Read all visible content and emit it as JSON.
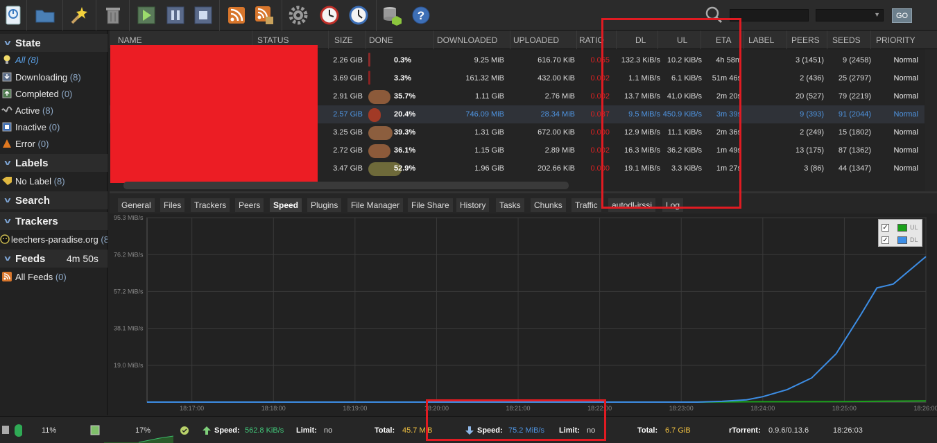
{
  "toolbar": {
    "buttons": [
      "add-torrent",
      "add-url",
      "create-torrent",
      "remove",
      "start",
      "pause",
      "stop",
      "rss",
      "rss-feeds",
      "settings",
      "scheduler",
      "time",
      "plugins",
      "help"
    ],
    "search_placeholder": "",
    "search_engine_selected": "",
    "go_label": "GO"
  },
  "sidebar": {
    "state": {
      "title": "State",
      "items": [
        {
          "label": "All",
          "count": "(8)",
          "icon": "bulb-icon"
        },
        {
          "label": "Downloading",
          "count": "(8)",
          "icon": "download-icon"
        },
        {
          "label": "Completed",
          "count": "(0)",
          "icon": "completed-icon"
        },
        {
          "label": "Active",
          "count": "(8)",
          "icon": "active-icon"
        },
        {
          "label": "Inactive",
          "count": "(0)",
          "icon": "inactive-icon"
        },
        {
          "label": "Error",
          "count": "(0)",
          "icon": "error-icon"
        }
      ]
    },
    "labels": {
      "title": "Labels",
      "items": [
        {
          "label": "No Label",
          "count": "(8)"
        }
      ]
    },
    "search": {
      "title": "Search"
    },
    "trackers": {
      "title": "Trackers",
      "items": [
        {
          "label": "leechers-paradise.org",
          "count": "(8"
        }
      ]
    },
    "feeds": {
      "title": "Feeds",
      "timer": "4m 50s",
      "items": [
        {
          "label": "All Feeds",
          "count": "(0)"
        }
      ]
    }
  },
  "list": {
    "columns": [
      "NAME",
      "STATUS",
      "SIZE",
      "DONE",
      "DOWNLOADED",
      "UPLOADED",
      "RATIO",
      "DL",
      "UL",
      "ETA",
      "LABEL",
      "PEERS",
      "SEEDS",
      "PRIORITY"
    ],
    "rows": [
      {
        "size": "2.26 GiB",
        "done": "0.3%",
        "downloaded": "9.25 MiB",
        "uploaded": "616.70 KiB",
        "ratio": "0.065",
        "dl": "132.3 KiB/s",
        "ul": "10.2 KiB/s",
        "eta": "4h 58m",
        "peers": "3 (1451)",
        "seeds": "9 (2458)",
        "priority": "Normal",
        "progress": 0.003,
        "blob_color": "#8a2a2a"
      },
      {
        "size": "3.69 GiB",
        "done": "3.3%",
        "downloaded": "161.32 MiB",
        "uploaded": "432.00 KiB",
        "ratio": "0.002",
        "dl": "1.1 MiB/s",
        "ul": "6.1 KiB/s",
        "eta": "51m 46s",
        "peers": "2 (436)",
        "seeds": "25 (2797)",
        "priority": "Normal",
        "progress": 0.033,
        "blob_color": "#8a2222"
      },
      {
        "size": "2.91 GiB",
        "done": "35.7%",
        "downloaded": "1.11 GiB",
        "uploaded": "2.76 MiB",
        "ratio": "0.002",
        "dl": "13.7 MiB/s",
        "ul": "41.0 KiB/s",
        "eta": "2m 20s",
        "peers": "20 (527)",
        "seeds": "79 (2219)",
        "priority": "Normal",
        "progress": 0.357,
        "blob_color": "#8c5a3a"
      },
      {
        "size": "2.57 GiB",
        "done": "20.4%",
        "downloaded": "746.09 MiB",
        "uploaded": "28.34 MiB",
        "ratio": "0.037",
        "dl": "9.5 MiB/s",
        "ul": "450.9 KiB/s",
        "eta": "3m 39s",
        "peers": "9 (393)",
        "seeds": "91 (2044)",
        "priority": "Normal",
        "progress": 0.204,
        "blob_color": "#a23a26",
        "selected": true
      },
      {
        "size": "3.25 GiB",
        "done": "39.3%",
        "downloaded": "1.31 GiB",
        "uploaded": "672.00 KiB",
        "ratio": "0.000",
        "dl": "12.9 MiB/s",
        "ul": "11.1 KiB/s",
        "eta": "2m 36s",
        "peers": "2 (249)",
        "seeds": "15 (1802)",
        "priority": "Normal",
        "progress": 0.393,
        "blob_color": "#8c5e3e"
      },
      {
        "size": "2.72 GiB",
        "done": "36.1%",
        "downloaded": "1.15 GiB",
        "uploaded": "2.89 MiB",
        "ratio": "0.002",
        "dl": "16.3 MiB/s",
        "ul": "36.2 KiB/s",
        "eta": "1m 49s",
        "peers": "13 (175)",
        "seeds": "87 (1362)",
        "priority": "Normal",
        "progress": 0.361,
        "blob_color": "#8c5a3a"
      },
      {
        "size": "3.47 GiB",
        "done": "52.9%",
        "downloaded": "1.96 GiB",
        "uploaded": "202.66 KiB",
        "ratio": "0.000",
        "dl": "19.1 MiB/s",
        "ul": "3.3 KiB/s",
        "eta": "1m 27s",
        "peers": "3 (86)",
        "seeds": "44 (1347)",
        "priority": "Normal",
        "progress": 0.529,
        "blob_color": "#6e6a3a"
      }
    ]
  },
  "tabs": [
    "General",
    "Files",
    "Trackers",
    "Peers",
    "Speed",
    "Plugins",
    "File Manager",
    "File Share",
    "History",
    "Tasks",
    "Chunks",
    "Traffic",
    "autodl-irssi",
    "Log"
  ],
  "active_tab": "Speed",
  "chart_data": {
    "type": "line",
    "title": "",
    "xlabel": "",
    "ylabel": "",
    "y_ticks": [
      "95.3 MiB/s",
      "76.2 MiB/s",
      "57.2 MiB/s",
      "38.1 MiB/s",
      "19.0 MiB/s"
    ],
    "y_tick_values": [
      95.3,
      76.2,
      57.2,
      38.1,
      19.0
    ],
    "x_ticks": [
      "18:17:00",
      "18:18:00",
      "18:19:00",
      "18:20:00",
      "18:21:00",
      "18:22:00",
      "18:23:00",
      "18:24:00",
      "18:25:00",
      "18:26:00"
    ],
    "ylim": [
      0,
      95.3
    ],
    "xlim_minutes": [
      16.45,
      26.0
    ],
    "series": [
      {
        "name": "UL",
        "color": "#1aa01a",
        "x_minutes": [
          16.45,
          23.0,
          24.0,
          25.0,
          26.0
        ],
        "values": [
          0,
          0,
          0.2,
          0.3,
          0.6
        ]
      },
      {
        "name": "DL",
        "color": "#3d8ee6",
        "x_minutes": [
          16.45,
          23.2,
          23.5,
          23.8,
          24.0,
          24.3,
          24.6,
          24.9,
          25.2,
          25.4,
          25.6,
          26.0
        ],
        "values": [
          0,
          0,
          0.4,
          1.2,
          2.8,
          6.5,
          12.5,
          25,
          45,
          59,
          61,
          75.2
        ]
      }
    ],
    "grid": true,
    "legend": "top-right"
  },
  "statusbar": {
    "disk_pct": "11%",
    "mem_pct": "17%",
    "up_speed_label": "Speed:",
    "up_speed": "562.8 KiB/s",
    "up_limit_label": "Limit:",
    "up_limit": "no",
    "up_total_label": "Total:",
    "up_total": "45.7 MiB",
    "dn_speed_label": "Speed:",
    "dn_speed": "75.2 MiB/s",
    "dn_limit_label": "Limit:",
    "dn_limit": "no",
    "dn_total_label": "Total:",
    "dn_total": "6.7 GiB",
    "client_label": "rTorrent:",
    "client_version": "0.9.6/0.13.6",
    "time": "18:26:03"
  },
  "colors": {
    "highlight": "#e01b22",
    "accent_blue": "#4f94e0",
    "up_green": "#42c87a",
    "total_yellow": "#f0c040"
  }
}
